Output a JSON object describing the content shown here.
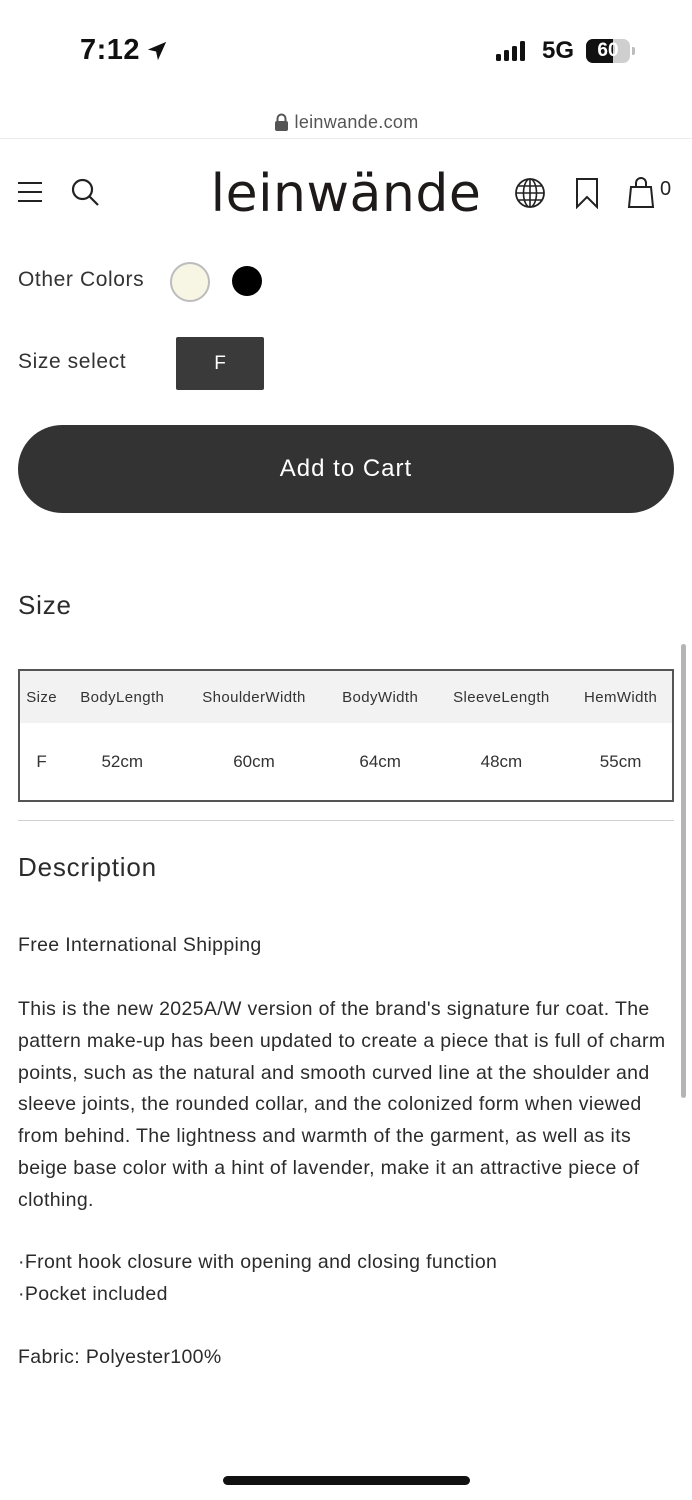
{
  "status_bar": {
    "time": "7:12",
    "network": "5G",
    "battery": "60"
  },
  "browser": {
    "url": "leinwande.com"
  },
  "header": {
    "logo": "leinwände",
    "cart_count": "0"
  },
  "product_options": {
    "colors_label": "Other Colors",
    "colors": [
      {
        "name": "cream",
        "hex": "#f7f5e4",
        "selected": true
      },
      {
        "name": "black",
        "hex": "#000000",
        "selected": false
      }
    ],
    "size_label": "Size select",
    "size_value": "F",
    "add_to_cart": "Add to Cart"
  },
  "size_section": {
    "title": "Size",
    "headers": [
      "Size",
      "BodyLength",
      "ShoulderWidth",
      "BodyWidth",
      "SleeveLength",
      "HemWidth"
    ],
    "rows": [
      [
        "F",
        "52cm",
        "60cm",
        "64cm",
        "48cm",
        "55cm"
      ]
    ]
  },
  "description": {
    "title": "Description",
    "shipping": "Free International Shipping",
    "body": "This is the new 2025A/W version of the brand's signature fur coat. The pattern make-up has been updated to create a piece that is full of charm points, such as the natural and smooth curved line at the shoulder and sleeve joints, the rounded collar, and the colonized form when viewed from behind. The lightness and warmth of the garment, as well as its beige base color with a hint of lavender, make it an attractive piece of clothing.",
    "bullet_1": "·Front hook closure with opening and closing function",
    "bullet_2": "·Pocket included",
    "fabric": "Fabric: Polyester100%"
  },
  "icons": [
    "location-arrow-icon",
    "signal-icon",
    "battery-icon",
    "lock-icon",
    "menu-icon",
    "search-icon",
    "globe-icon",
    "bookmark-icon",
    "bag-icon"
  ]
}
